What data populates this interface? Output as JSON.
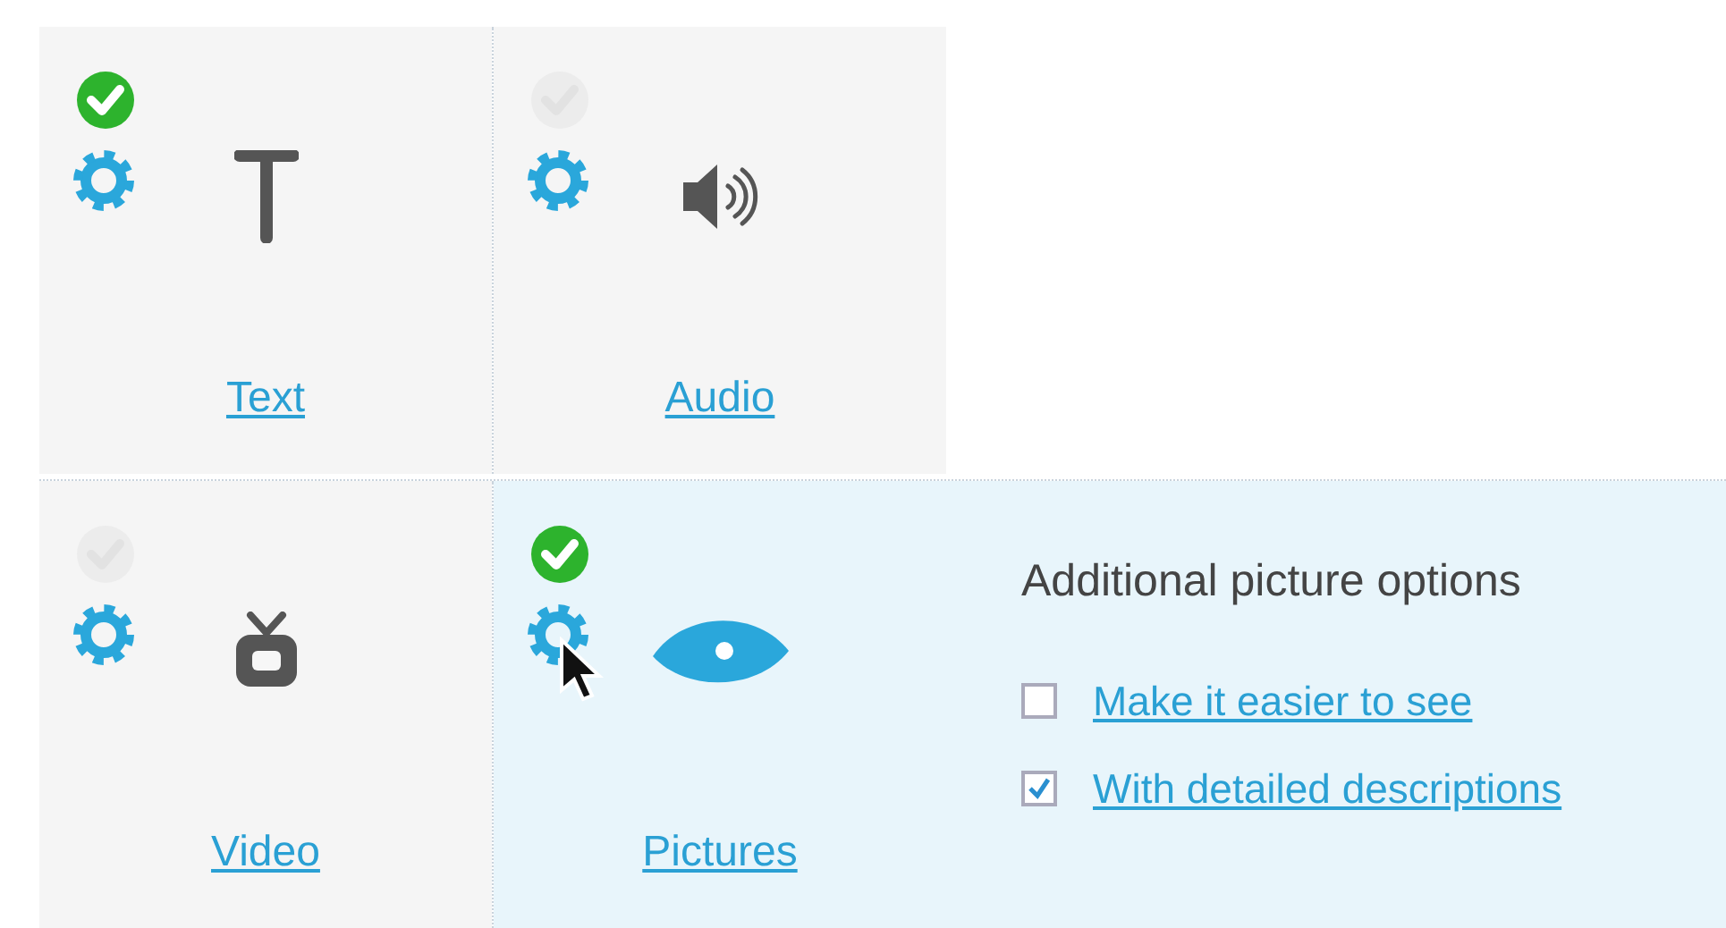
{
  "tiles": [
    {
      "kind": "text",
      "label": "Text",
      "checked": true,
      "selected": false
    },
    {
      "kind": "audio",
      "label": "Audio",
      "checked": false,
      "selected": false
    },
    {
      "kind": "video",
      "label": "Video",
      "checked": false,
      "selected": false
    },
    {
      "kind": "pictures",
      "label": "Pictures",
      "checked": true,
      "selected": true
    }
  ],
  "options_panel": {
    "title": "Additional picture options",
    "options": [
      {
        "label": "Make it easier to see",
        "checked": false
      },
      {
        "label": "With detailed descriptions",
        "checked": true
      }
    ]
  }
}
